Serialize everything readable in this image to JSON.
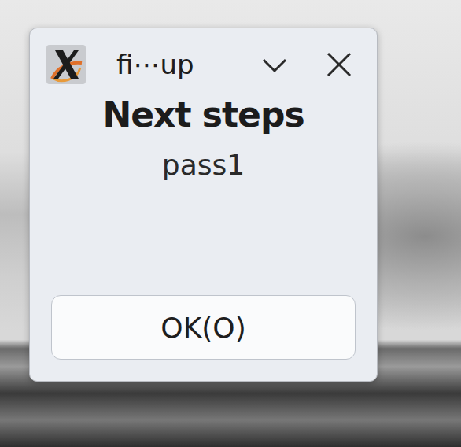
{
  "window": {
    "title": "fi⋯up"
  },
  "heading": "Next steps",
  "message": "pass1",
  "buttons": [
    "OK(O)"
  ]
}
